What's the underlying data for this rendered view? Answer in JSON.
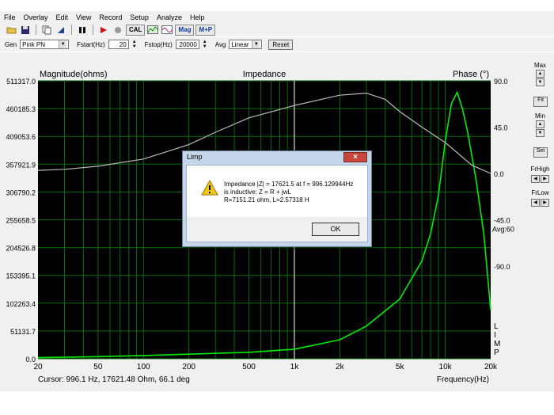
{
  "menu": [
    "File",
    "Overlay",
    "Edit",
    "View",
    "Record",
    "Setup",
    "Analyze",
    "Help"
  ],
  "toolbar": {
    "cal_label": "CAL",
    "mag_label": "Mag",
    "mp_label": "M+P"
  },
  "generator": {
    "gen_label": "Gen",
    "gen_value": "Pink PN",
    "fstart_label": "Fstart(Hz)",
    "fstart_value": "20",
    "fstop_label": "Fstop(Hz)",
    "fstop_value": "20000",
    "avg_label": "Avg",
    "avg_value": "Linear",
    "reset_label": "Reset"
  },
  "plot": {
    "left_title": "Magnitude(ohms)",
    "center_title": "Impedance",
    "right_title": "Phase (°)",
    "y_left_ticks": [
      "511317.0",
      "460185.3",
      "409053.6",
      "357921.9",
      "306790.2",
      "255658.5",
      "204526.8",
      "153395.1",
      "102263.4",
      "51131.7",
      "0.0"
    ],
    "y_right_ticks": [
      "90.0",
      "45.0",
      "0.0",
      "-45.0",
      "-90.0"
    ],
    "avg_text": "Avg:60",
    "x_ticks": [
      "20",
      "50",
      "100",
      "200",
      "500",
      "1k",
      "2k",
      "5k",
      "10k",
      "20k"
    ],
    "side_letters": [
      "L",
      "I",
      "M",
      "P"
    ],
    "cursor_text": "Cursor:  996.1 Hz, 17621.48 Ohm, 66.1 deg",
    "x_label": "Frequency(Hz)"
  },
  "right_panel": {
    "max_label": "Max",
    "fit_label": "Fit",
    "min_label": "Min",
    "set_label": "Set",
    "frhigh_label": "FrHigh",
    "frlow_label": "FrLow"
  },
  "dialog": {
    "title": "Limp",
    "line1": "Impedance |Z| = 17621.5 at f = 996.129944Hz",
    "line2": "is inductive: Z = R + jwL",
    "line3": "R=7151.21 ohm, L=2.57318 H",
    "ok_label": "OK"
  },
  "chart_data": {
    "type": "line",
    "title": "Impedance",
    "xlabel": "Frequency(Hz)",
    "ylabel": "Magnitude(ohms)",
    "y2label": "Phase (°)",
    "xscale": "log",
    "xlim": [
      20,
      20000
    ],
    "ylim": [
      0,
      511317.0
    ],
    "y2lim": [
      -180,
      90
    ],
    "grid": true,
    "series": [
      {
        "color": "#00ee00",
        "axis": "left",
        "x": [
          20,
          50,
          100,
          200,
          500,
          1000,
          2000,
          3000,
          5000,
          7000,
          8000,
          9000,
          10000,
          11000,
          12000,
          13000,
          14000,
          16000,
          18000,
          20000
        ],
        "y": [
          2000,
          4000,
          6000,
          8500,
          12000,
          17621,
          35000,
          60000,
          110000,
          180000,
          230000,
          300000,
          400000,
          470000,
          490000,
          460000,
          420000,
          330000,
          230000,
          90000
        ]
      },
      {
        "color": "#bbbbbb",
        "axis": "right",
        "x": [
          20,
          30,
          50,
          100,
          200,
          300,
          500,
          1000,
          2000,
          3000,
          4000,
          5000,
          7000,
          10000,
          15000,
          20000
        ],
        "y": [
          3,
          4,
          7,
          14,
          28,
          40,
          54,
          66,
          76,
          78,
          72,
          60,
          45,
          30,
          8,
          0
        ]
      }
    ]
  }
}
